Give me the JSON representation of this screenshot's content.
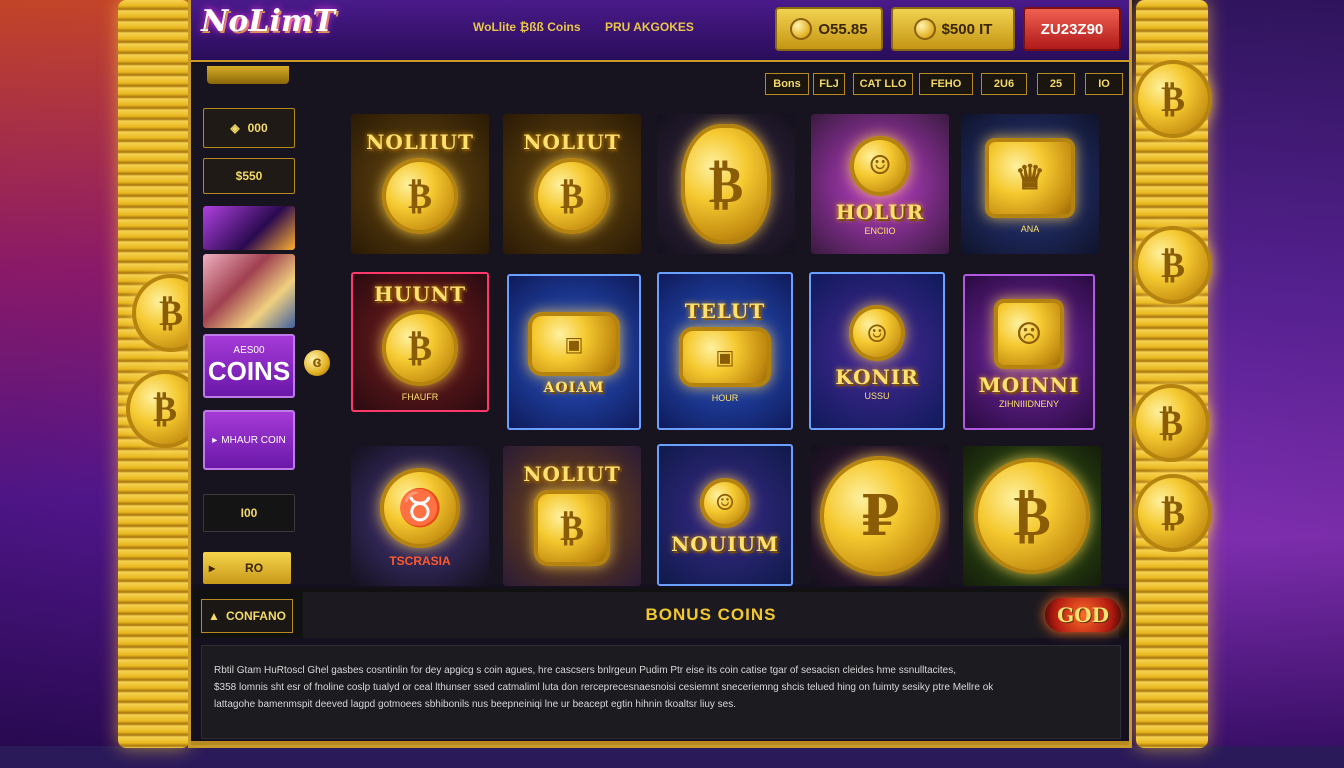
{
  "header": {
    "logo": "NoLimT",
    "nav_link_1": "WoLlite ₿ßß Coins",
    "nav_link_2": "PRU AKGOKES",
    "balance_1": "O55.85",
    "balance_2": "$500 IT",
    "balance_3": "ZU23Z90"
  },
  "filters": [
    "Bons",
    "FLJ",
    "CAT LLO",
    "FEHO",
    "2U6",
    "25",
    "IO"
  ],
  "sidebar": {
    "item_1": "000",
    "item_2": "$550",
    "coins_small": "AES00",
    "coins_big": "COINS",
    "bonus_coin": "MHAUR COIN",
    "item_dark": "I00",
    "item_yellow": "RO"
  },
  "games": [
    {
      "title": "NOLIIUT",
      "sub": ""
    },
    {
      "title": "NOLIUT",
      "sub": ""
    },
    {
      "title": "",
      "sub": ""
    },
    {
      "title": "HOLUR",
      "sub": "ENCIIO"
    },
    {
      "title": "",
      "sub": "ANA"
    },
    {
      "title": "HUUNT",
      "sub": "FHAUFR"
    },
    {
      "title": "AOIAM",
      "sub": ""
    },
    {
      "title": "TELUT",
      "sub": "HOUR"
    },
    {
      "title": "KONIR",
      "sub": "USSU"
    },
    {
      "title": "MOINNI",
      "sub": "ZIHNIIIDNENY"
    },
    {
      "title": "",
      "sub": "TSCRASIA"
    },
    {
      "title": "NOLIUT",
      "sub": ""
    },
    {
      "title": "NOUIUM",
      "sub": ""
    },
    {
      "title": "",
      "sub": ""
    },
    {
      "title": "",
      "sub": ""
    }
  ],
  "bonus": {
    "left_label": "CONFANO",
    "title": "BONUS COINS",
    "badge": "GOD"
  },
  "description": {
    "line_1": "Rbtil Gtam HuRtoscl Ghel gasbes cosntinlin for dey apgicg s coin agues, hre cascsers bnlrgeun Pudim Ptr eise its coin catise tgar of sesacisn cleides hme ssnulltacites,",
    "line_2": "$358 lomnis sht esr of fnoline coslp tualyd or ceal lthunser ssed catmaliml luta don rerceprecesnaesnoisi cesiemnt sneceriemng shcis telued hing on fuimty sesiky ptre Mellre ok",
    "line_3": "lattagohe bamenmspit deeved lagpd gotmoees sbhibonils nus beepneiniqi lne ur beacept egtin hihnin tkoaltsr liuy ses."
  },
  "colors": {
    "gold": "#e8b81f",
    "purple": "#6a18a8",
    "accent_red": "#b01a1a"
  }
}
